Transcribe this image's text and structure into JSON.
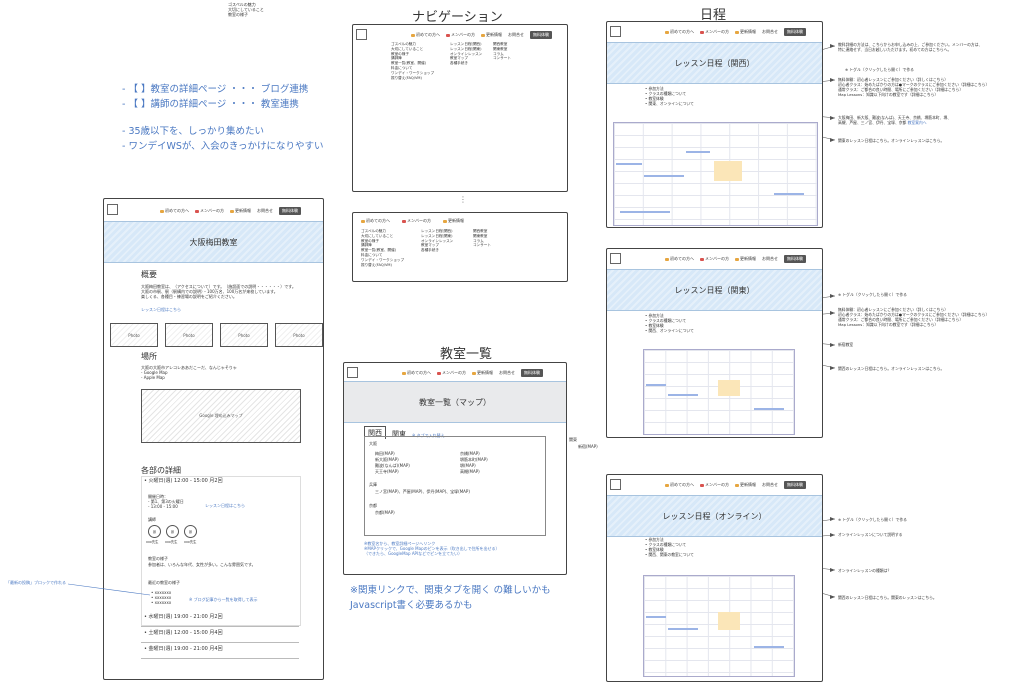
{
  "nav": {
    "first_time": "初めての方へ",
    "members": "メンバーの方",
    "updates": "更新情報",
    "contact": "お問合せ",
    "trial": "無料体験"
  },
  "colors": {
    "accent_blue": "#4a78c2",
    "hero_bg": "#d7e8f8"
  },
  "top_snippet": [
    "ゴスペルの魅力",
    "大切にしていること",
    "教室の様子"
  ],
  "notes": {
    "lines": [
      "- 【 】教室の詳細ページ ・・・ ブログ連携",
      "- 【 】講師の詳細ページ ・・・ 教室連携",
      "",
      "- 35歳以下を、しっかり集めたい",
      "- ワンデイWSが、入会のきっかけになりやすい"
    ]
  },
  "nav_section": {
    "title": "ナビゲーション",
    "col1": [
      "ゴスペルの魅力",
      "大切にしていること",
      "教室の様子",
      "講師陣",
      "教室一覧(教室、開催)",
      "料金について",
      "ワンデイ・ワークショップ",
      "振り替え(FAQ/VM)"
    ],
    "col2": [
      "レッスン日程(関西)",
      "レッスン日程(関東)",
      "オンラインレッスン",
      "教室マップ",
      "各種手続き"
    ],
    "col3": [
      "関西教室",
      "関東教室",
      "コラム",
      "コンサート"
    ],
    "ellipsis": "⋮"
  },
  "classroom_list": {
    "title": "教室一覧",
    "hero": "教室一覧（マップ）",
    "tab_kansai": "関西",
    "tab_kanto": "関東",
    "tab_note": "※ タブで入れ替え",
    "pref_osaka": "大阪",
    "osaka_col1": [
      "梅田(MAP)",
      "新大阪(MAP)",
      "難波(なんば)(MAP)",
      "天王寺(MAP)"
    ],
    "osaka_col2": [
      "京橋(MAP)",
      "堺筋本町(MAP)",
      "堺(MAP)",
      "高槻(MAP)"
    ],
    "pref_hyogo": "兵庫",
    "hyogo_line": "三ノ宮(MAP)、芦屋(MAP)、伊丹(MAP)、宝塚(MAP)",
    "pref_kyoto": "京都",
    "kyoto_line": "京都(MAP)",
    "blue_notes": [
      "※教室名から、教室詳細ページへリンク",
      "※MAPクリックで、Google Mapのピンを表示（吹き出しで住所を出せる）",
      "（できたら、GoogleMap APIなどでピンを立てたい）"
    ],
    "side_kanto": "関東",
    "side_shinjuku": "新宿(MAP)",
    "bottom_note_1": "※関東リンクで、関東タブを開く の難しいかも",
    "bottom_note_2": "Javascript書く必要あるかも"
  },
  "umeda": {
    "hero": "大阪梅田教室",
    "overview_title": "概要",
    "overview_lines": [
      "大阪梅田教室は、（アクセスについて）です。（施設面での説明・・・・・・）です。",
      "大阪の市駅、駅（駅構内での説明）・100万名、100万名が来校しています。",
      "楽しくる、各種目・練習場の説明をご紹介ください。"
    ],
    "schedule_link": "レッスン日程はこちら",
    "photos": [
      "Photo",
      "Photo",
      "Photo",
      "Photo"
    ],
    "location_title": "場所",
    "location_lines": [
      "大阪の大阪市アレコレああだこーだ、なんじゃそりゃ",
      "- Google Map",
      "- Apple Map"
    ],
    "map_label": "Google 埋め込みマップ",
    "details_title": "各部の詳細",
    "session1": "• 火曜日(週) 12:00 - 15:00 月2回",
    "session1_body": [
      "開催日時：",
      "- 第1、第3の火曜日",
      "- 13:00 - 15:00"
    ],
    "session1_link": "レッスン日程はこちら",
    "teachers_label": "講師",
    "teacher_names": [
      "xxx先生",
      "xxx先生",
      "xxx先生"
    ],
    "teacher_avatars": [
      "顔",
      "顔",
      "顔"
    ],
    "atmosphere_label": "教室の様子",
    "atmosphere_text": "参加者は、いろんな年代、女性が多い。こんな雰囲気です。",
    "recent_label": "最近の教室の様子",
    "recent_items": [
      "• xxxxxxx",
      "• xxxxxxx",
      "• xxxxxxx"
    ],
    "blog_link": "※ ブログ記事から一覧を取得して表示",
    "side_note": "「最新の投稿」ブロックで作れる",
    "session2": "• 水曜日(週) 19:00 - 21:00 月2回",
    "session3": "• 土曜日(週) 12:00 - 15:00 月4回",
    "session4": "• 金曜日(週) 19:00 - 21:00 月4回"
  },
  "schedule_section": {
    "title": "日程",
    "kansai_hero": "レッスン日程（関西）",
    "kanto_hero": "レッスン日程（関東）",
    "online_hero": "レッスン日程（オンライン）",
    "bullets_kansai": [
      "• 参加方法",
      "• クラスの種類について",
      "• 教室体験",
      "• 関東、オンラインについて"
    ],
    "bullets_kanto": [
      "• 参加方法",
      "• クラスの種類について",
      "• 教室体験",
      "• 関西、オンラインについて"
    ],
    "bullets_online": [
      "• 参加方法",
      "• クラスの種類について",
      "• 教室体験",
      "• 関西、関東の教室について"
    ],
    "annot_top": [
      "教科詳細の方法は、こちらからお申し込みの上、ご参加ください。メンバーの方は、",
      "特に連絡せず、当日お越しいただけます。初めての方はこちらへ。"
    ],
    "toggle": "※ トグル（クリックしたら開く）で作る",
    "trial_lines": [
      "無料体験：初心者レッスンにご参加ください（詳しくはこちら）",
      "初心者クラス：始めたばかりの方は●マークのクラスにご参加ください（詳細はこちら）",
      "通常クラス：ご都合の良い時間、場所にご参加ください（詳細はこちら）",
      "Map Lessons：知識以下向けの教室です（詳細はこちら）"
    ],
    "kansai_places": [
      "大阪梅田、新大阪、難波(なんば)、天王寺、京橋、堺筋本町、堺、",
      "高槻、芦屋、三ノ宮、伊丹、宝塚、京都"
    ],
    "classroom_link": "教室案内へ",
    "kanto_link": "関東のレッスン日程はこちら。オンラインレッスンはこちら。",
    "kanto_place": "新宿教室",
    "kanto_link2": "関西のレッスン日程はこちら。オンラインレッスンはこちら。",
    "online_annot": "オンラインレッスンについて説明する",
    "online_q": "オンラインレッスンの種類は？",
    "online_link": "関西のレッスン日程はこちら。関東のレッスンはこちら。"
  }
}
